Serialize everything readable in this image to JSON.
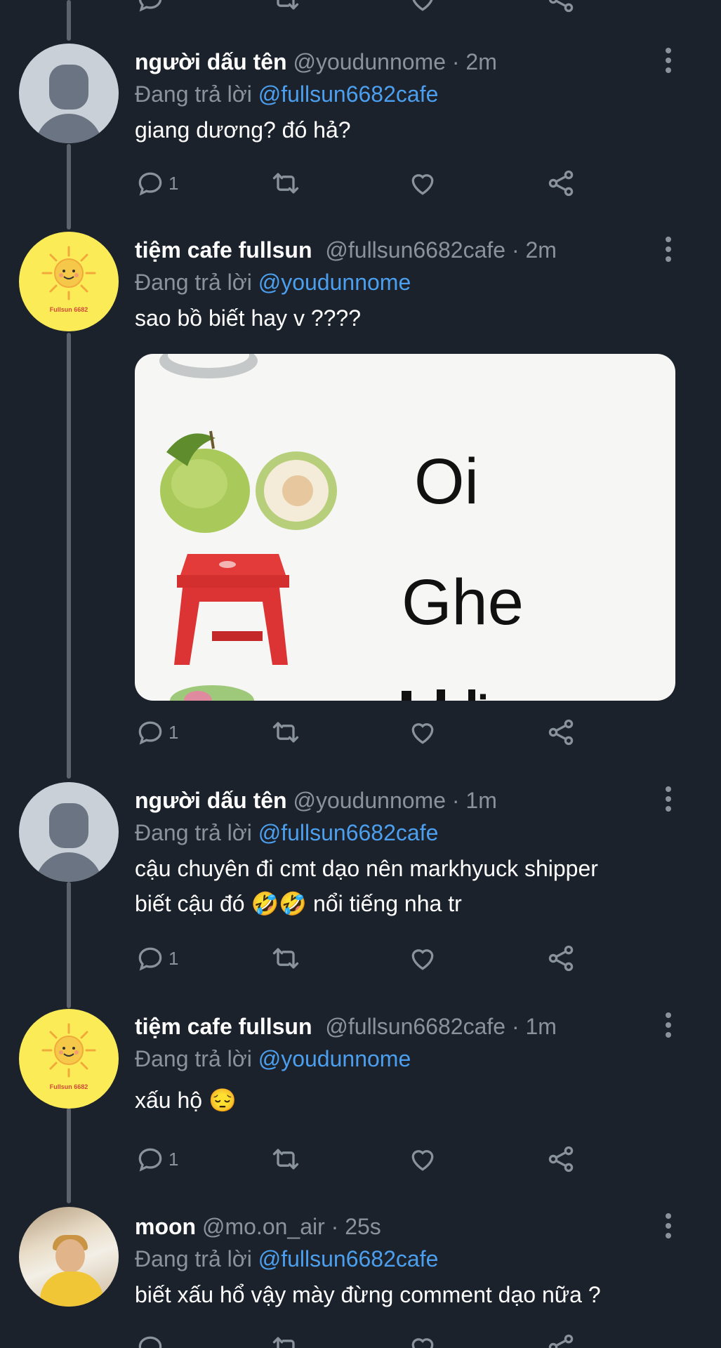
{
  "tweets": [
    {
      "name": "người dấu tên",
      "handle": "@youdunnome",
      "dot": "·",
      "time": "2m",
      "reply_prefix": "Đang trả lời",
      "reply_to": "@fullsun6682cafe",
      "text": "giang dương? đó hả?",
      "reply_count": "1"
    },
    {
      "name": "tiệm cafe fullsun",
      "handle": "@fullsun6682cafe",
      "dot": "·",
      "time": "2m",
      "reply_prefix": "Đang trả lời",
      "reply_to": "@youdunnome",
      "text": "sao bồ biết hay v ????",
      "reply_count": "1",
      "avatar_text": "Fullsun 6682",
      "media": {
        "words": [
          "Oi",
          "Ghe",
          "Vai"
        ]
      }
    },
    {
      "name": "người dấu tên",
      "handle": "@youdunnome",
      "dot": "·",
      "time": "1m",
      "reply_prefix": "Đang trả lời",
      "reply_to": "@fullsun6682cafe",
      "text_line1": "cậu chuyên đi cmt dạo nên markhyuck shipper",
      "text_line2": "biết cậu đó 🤣🤣 nổi tiếng nha tr",
      "reply_count": "1"
    },
    {
      "name": "tiệm cafe fullsun",
      "handle": "@fullsun6682cafe",
      "dot": "·",
      "time": "1m",
      "reply_prefix": "Đang trả lời",
      "reply_to": "@youdunnome",
      "text": "xấu hộ 😔",
      "reply_count": "1",
      "avatar_text": "Fullsun 6682"
    },
    {
      "name": "moon",
      "handle": "@mo.on_air",
      "dot": "·",
      "time": "25s",
      "reply_prefix": "Đang trả lời",
      "reply_to": "@fullsun6682cafe",
      "text": "biết xấu hổ vậy mày đừng comment dạo nữa ?"
    }
  ],
  "icons": {
    "reply": "reply-icon",
    "retweet": "retweet-icon",
    "like": "heart-icon",
    "share": "share-icon",
    "more": "more-vertical-icon"
  },
  "colors": {
    "background": "#1b222b",
    "mention": "#4c9fee",
    "muted": "#8a939c",
    "sun_avatar": "#fbeb56"
  }
}
